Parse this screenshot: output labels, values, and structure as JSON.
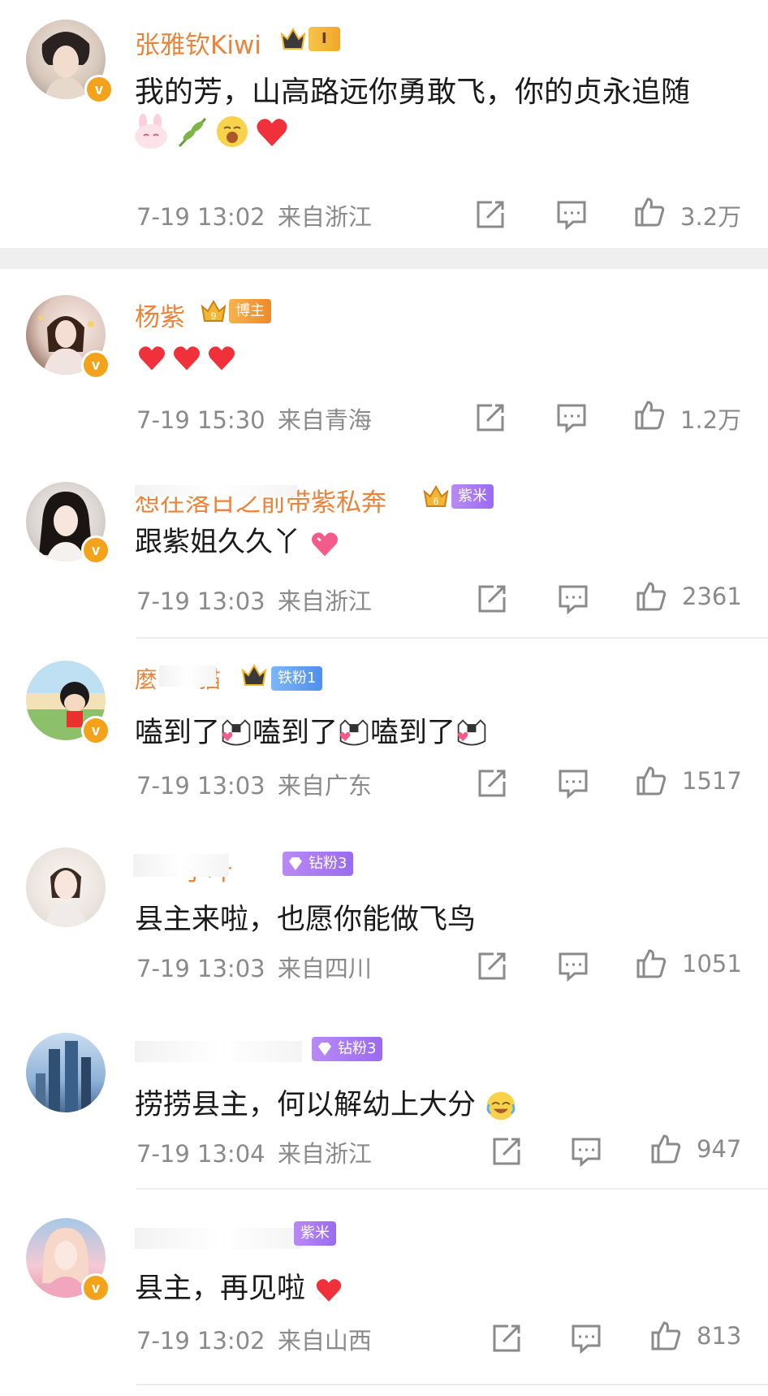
{
  "colors": {
    "username": "#e8843b",
    "meta": "#8a8a8a",
    "vip": "#f2a31b",
    "heart": "#f0303a",
    "purple_badge": "#9a6bf0",
    "blue_badge": "#5c9cf5"
  },
  "comments": [
    {
      "user": "张雅钦Kiwi",
      "level_badge": "I",
      "text": "我的芳，山高路远你勇敢飞，你的贞永追随",
      "time": "7-19 13:02",
      "location": "来自浙江",
      "likes": "3.2万"
    },
    {
      "user": "杨紫",
      "level_badge": "9",
      "badge": "博主",
      "time": "7-19 15:30",
      "location": "来自青海",
      "likes": "1.2万"
    },
    {
      "user": "想在落日之前带紫私奔",
      "level_badge": "6",
      "badge": "紫米",
      "text": "跟紫姐久久丫",
      "time": "7-19 13:03",
      "location": "来自浙江",
      "likes": "2361"
    },
    {
      "user": "麼",
      "user_end": "猫",
      "badge": "铁粉1",
      "text_parts": [
        "嗑到了",
        "嗑到了",
        "嗑到了"
      ],
      "time": "7-19 13:03",
      "location": "来自广东",
      "likes": "1517"
    },
    {
      "user": "子叶",
      "badge": "钻粉3",
      "text": "县主来啦，也愿你能做飞鸟",
      "time": "7-19 13:03",
      "location": "来自四川",
      "likes": "1051"
    },
    {
      "badge": "钻粉3",
      "text": "捞捞县主，何以解幼上大分",
      "time": "7-19 13:04",
      "location": "来自浙江",
      "likes": "947"
    },
    {
      "badge": "紫米",
      "text": "县主，再见啦",
      "time": "7-19 13:02",
      "location": "来自山西",
      "likes": "813"
    }
  ]
}
